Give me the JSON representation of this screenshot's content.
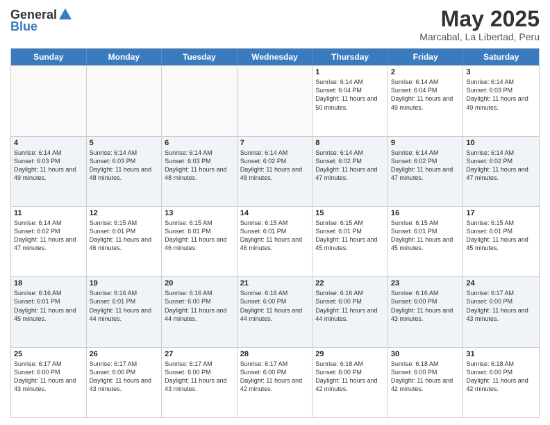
{
  "logo": {
    "general": "General",
    "blue": "Blue"
  },
  "header": {
    "month": "May 2025",
    "location": "Marcabal, La Libertad, Peru"
  },
  "weekdays": [
    "Sunday",
    "Monday",
    "Tuesday",
    "Wednesday",
    "Thursday",
    "Friday",
    "Saturday"
  ],
  "weeks": [
    {
      "alt": false,
      "days": [
        {
          "num": "",
          "sunrise": "",
          "sunset": "",
          "daylight": ""
        },
        {
          "num": "",
          "sunrise": "",
          "sunset": "",
          "daylight": ""
        },
        {
          "num": "",
          "sunrise": "",
          "sunset": "",
          "daylight": ""
        },
        {
          "num": "",
          "sunrise": "",
          "sunset": "",
          "daylight": ""
        },
        {
          "num": "1",
          "sunrise": "Sunrise: 6:14 AM",
          "sunset": "Sunset: 6:04 PM",
          "daylight": "Daylight: 11 hours and 50 minutes."
        },
        {
          "num": "2",
          "sunrise": "Sunrise: 6:14 AM",
          "sunset": "Sunset: 6:04 PM",
          "daylight": "Daylight: 11 hours and 49 minutes."
        },
        {
          "num": "3",
          "sunrise": "Sunrise: 6:14 AM",
          "sunset": "Sunset: 6:03 PM",
          "daylight": "Daylight: 11 hours and 49 minutes."
        }
      ]
    },
    {
      "alt": true,
      "days": [
        {
          "num": "4",
          "sunrise": "Sunrise: 6:14 AM",
          "sunset": "Sunset: 6:03 PM",
          "daylight": "Daylight: 11 hours and 49 minutes."
        },
        {
          "num": "5",
          "sunrise": "Sunrise: 6:14 AM",
          "sunset": "Sunset: 6:03 PM",
          "daylight": "Daylight: 11 hours and 48 minutes."
        },
        {
          "num": "6",
          "sunrise": "Sunrise: 6:14 AM",
          "sunset": "Sunset: 6:03 PM",
          "daylight": "Daylight: 11 hours and 48 minutes."
        },
        {
          "num": "7",
          "sunrise": "Sunrise: 6:14 AM",
          "sunset": "Sunset: 6:02 PM",
          "daylight": "Daylight: 11 hours and 48 minutes."
        },
        {
          "num": "8",
          "sunrise": "Sunrise: 6:14 AM",
          "sunset": "Sunset: 6:02 PM",
          "daylight": "Daylight: 11 hours and 47 minutes."
        },
        {
          "num": "9",
          "sunrise": "Sunrise: 6:14 AM",
          "sunset": "Sunset: 6:02 PM",
          "daylight": "Daylight: 11 hours and 47 minutes."
        },
        {
          "num": "10",
          "sunrise": "Sunrise: 6:14 AM",
          "sunset": "Sunset: 6:02 PM",
          "daylight": "Daylight: 11 hours and 47 minutes."
        }
      ]
    },
    {
      "alt": false,
      "days": [
        {
          "num": "11",
          "sunrise": "Sunrise: 6:14 AM",
          "sunset": "Sunset: 6:02 PM",
          "daylight": "Daylight: 11 hours and 47 minutes."
        },
        {
          "num": "12",
          "sunrise": "Sunrise: 6:15 AM",
          "sunset": "Sunset: 6:01 PM",
          "daylight": "Daylight: 11 hours and 46 minutes."
        },
        {
          "num": "13",
          "sunrise": "Sunrise: 6:15 AM",
          "sunset": "Sunset: 6:01 PM",
          "daylight": "Daylight: 11 hours and 46 minutes."
        },
        {
          "num": "14",
          "sunrise": "Sunrise: 6:15 AM",
          "sunset": "Sunset: 6:01 PM",
          "daylight": "Daylight: 11 hours and 46 minutes."
        },
        {
          "num": "15",
          "sunrise": "Sunrise: 6:15 AM",
          "sunset": "Sunset: 6:01 PM",
          "daylight": "Daylight: 11 hours and 45 minutes."
        },
        {
          "num": "16",
          "sunrise": "Sunrise: 6:15 AM",
          "sunset": "Sunset: 6:01 PM",
          "daylight": "Daylight: 11 hours and 45 minutes."
        },
        {
          "num": "17",
          "sunrise": "Sunrise: 6:15 AM",
          "sunset": "Sunset: 6:01 PM",
          "daylight": "Daylight: 11 hours and 45 minutes."
        }
      ]
    },
    {
      "alt": true,
      "days": [
        {
          "num": "18",
          "sunrise": "Sunrise: 6:16 AM",
          "sunset": "Sunset: 6:01 PM",
          "daylight": "Daylight: 11 hours and 45 minutes."
        },
        {
          "num": "19",
          "sunrise": "Sunrise: 6:16 AM",
          "sunset": "Sunset: 6:01 PM",
          "daylight": "Daylight: 11 hours and 44 minutes."
        },
        {
          "num": "20",
          "sunrise": "Sunrise: 6:16 AM",
          "sunset": "Sunset: 6:00 PM",
          "daylight": "Daylight: 11 hours and 44 minutes."
        },
        {
          "num": "21",
          "sunrise": "Sunrise: 6:16 AM",
          "sunset": "Sunset: 6:00 PM",
          "daylight": "Daylight: 11 hours and 44 minutes."
        },
        {
          "num": "22",
          "sunrise": "Sunrise: 6:16 AM",
          "sunset": "Sunset: 6:00 PM",
          "daylight": "Daylight: 11 hours and 44 minutes."
        },
        {
          "num": "23",
          "sunrise": "Sunrise: 6:16 AM",
          "sunset": "Sunset: 6:00 PM",
          "daylight": "Daylight: 11 hours and 43 minutes."
        },
        {
          "num": "24",
          "sunrise": "Sunrise: 6:17 AM",
          "sunset": "Sunset: 6:00 PM",
          "daylight": "Daylight: 11 hours and 43 minutes."
        }
      ]
    },
    {
      "alt": false,
      "days": [
        {
          "num": "25",
          "sunrise": "Sunrise: 6:17 AM",
          "sunset": "Sunset: 6:00 PM",
          "daylight": "Daylight: 11 hours and 43 minutes."
        },
        {
          "num": "26",
          "sunrise": "Sunrise: 6:17 AM",
          "sunset": "Sunset: 6:00 PM",
          "daylight": "Daylight: 11 hours and 43 minutes."
        },
        {
          "num": "27",
          "sunrise": "Sunrise: 6:17 AM",
          "sunset": "Sunset: 6:00 PM",
          "daylight": "Daylight: 11 hours and 43 minutes."
        },
        {
          "num": "28",
          "sunrise": "Sunrise: 6:17 AM",
          "sunset": "Sunset: 6:00 PM",
          "daylight": "Daylight: 11 hours and 42 minutes."
        },
        {
          "num": "29",
          "sunrise": "Sunrise: 6:18 AM",
          "sunset": "Sunset: 6:00 PM",
          "daylight": "Daylight: 11 hours and 42 minutes."
        },
        {
          "num": "30",
          "sunrise": "Sunrise: 6:18 AM",
          "sunset": "Sunset: 6:00 PM",
          "daylight": "Daylight: 11 hours and 42 minutes."
        },
        {
          "num": "31",
          "sunrise": "Sunrise: 6:18 AM",
          "sunset": "Sunset: 6:00 PM",
          "daylight": "Daylight: 11 hours and 42 minutes."
        }
      ]
    }
  ]
}
